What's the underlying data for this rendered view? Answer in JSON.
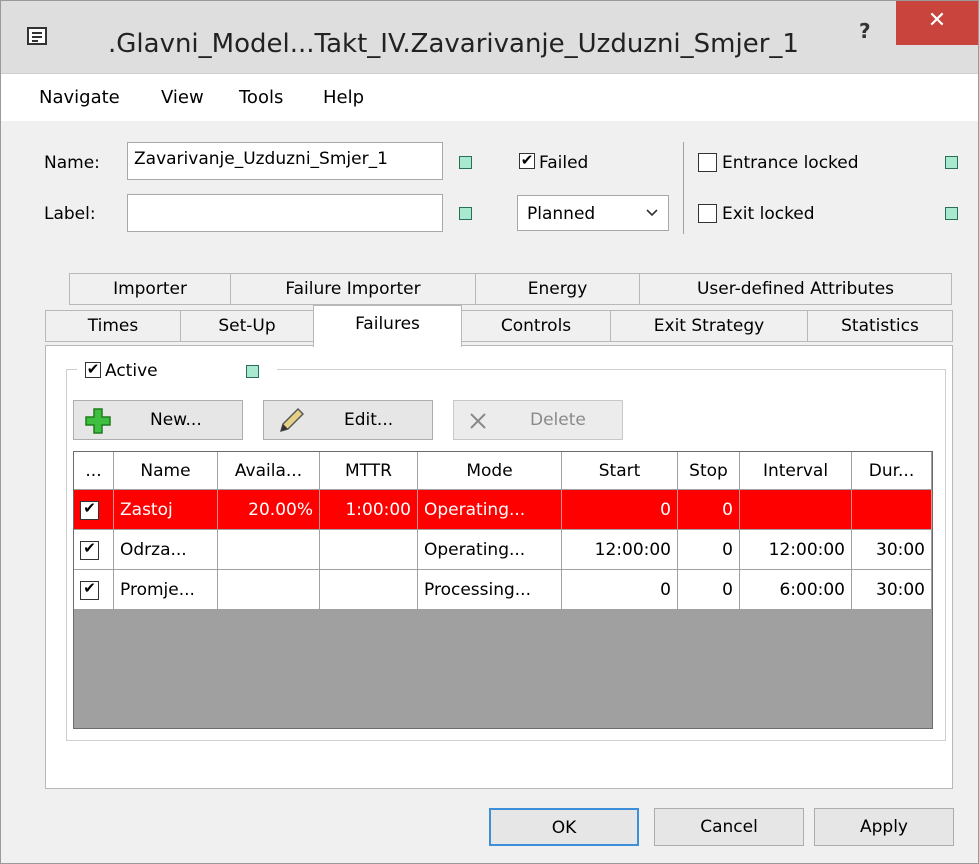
{
  "window": {
    "title": ".Glavni_Model...Takt_IV.Zavarivanje_Uzduzni_Smjer_1",
    "help_label": "?",
    "close_label": "✕"
  },
  "menu": [
    "Navigate",
    "View",
    "Tools",
    "Help"
  ],
  "fields": {
    "name_label": "Name:",
    "name_value": "Zavarivanje_Uzduzni_Smjer_1",
    "label_label": "Label:",
    "label_value": "",
    "failed_label": "Failed",
    "failed_checked": true,
    "planned_value": "Planned",
    "entrance_locked_label": "Entrance locked",
    "entrance_locked_checked": false,
    "exit_locked_label": "Exit locked",
    "exit_locked_checked": false
  },
  "tabs_row1": [
    "Importer",
    "Failure Importer",
    "Energy",
    "User-defined Attributes"
  ],
  "tabs_row2": [
    "Times",
    "Set-Up",
    "Failures",
    "Controls",
    "Exit Strategy",
    "Statistics"
  ],
  "active_tab": "Failures",
  "failures": {
    "active_label": "Active",
    "active_checked": true,
    "new_label": "New...",
    "edit_label": "Edit...",
    "delete_label": "Delete",
    "columns": [
      "...",
      "Name",
      "Availa...",
      "MTTR",
      "Mode",
      "Start",
      "Stop",
      "Interval",
      "Dur..."
    ],
    "rows": [
      {
        "checked": true,
        "name": "Zastoj",
        "avail": "20.00%",
        "mttr": "1:00:00",
        "mode": "Operating...",
        "start": "0",
        "stop": "0",
        "interval": "",
        "dur": "",
        "selected": true
      },
      {
        "checked": true,
        "name": "Odrza...",
        "avail": "",
        "mttr": "",
        "mode": "Operating...",
        "start": "12:00:00",
        "stop": "0",
        "interval": "12:00:00",
        "dur": "30:00",
        "selected": false
      },
      {
        "checked": true,
        "name": "Promje...",
        "avail": "",
        "mttr": "",
        "mode": "Processing...",
        "start": "0",
        "stop": "0",
        "interval": "6:00:00",
        "dur": "30:00",
        "selected": false
      }
    ]
  },
  "buttons": {
    "ok": "OK",
    "cancel": "Cancel",
    "apply": "Apply"
  },
  "check_glyph": "✔",
  "icons": {
    "new": "plus-icon",
    "edit": "pencil-icon",
    "delete": "x-icon",
    "combo": "chevron-down-icon"
  }
}
